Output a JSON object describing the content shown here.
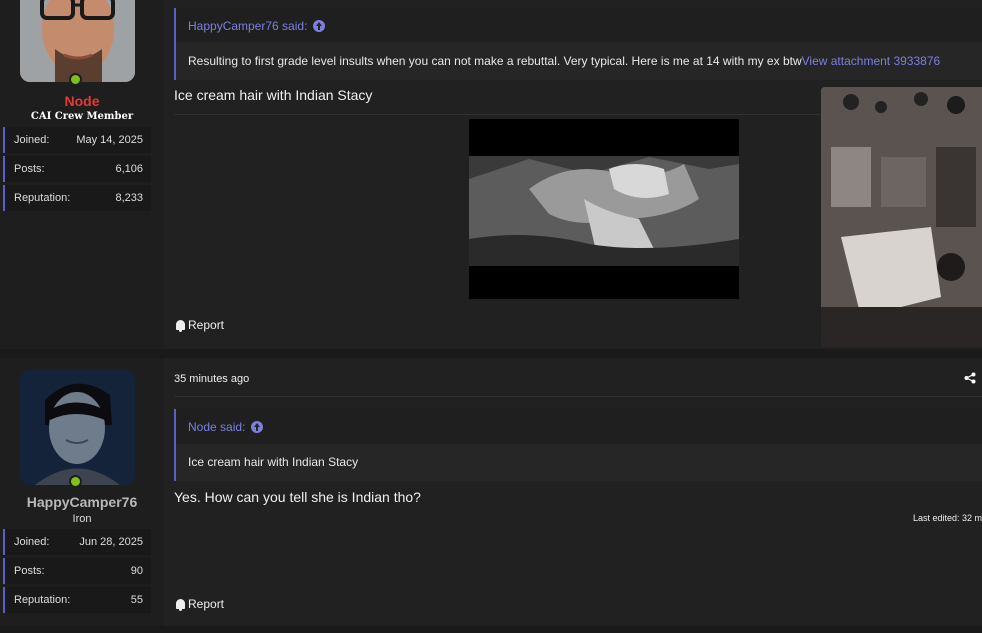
{
  "posts": [
    {
      "user": {
        "name": "Node",
        "title": "CAI Crew Member",
        "stats": [
          {
            "label": "Joined:",
            "value": "May 14, 2025"
          },
          {
            "label": "Posts:",
            "value": "6,106"
          },
          {
            "label": "Reputation:",
            "value": "8,233"
          }
        ]
      },
      "quote": {
        "author": "HappyCamper76 said:",
        "text": "Resulting to first grade level insults when you can not make a rebuttal. Very typical. Here is me at 14 with my ex btw",
        "link": "View attachment 3933876"
      },
      "body": "Ice cream hair with Indian Stacy",
      "report_label": "Report"
    },
    {
      "timestamp": "35 minutes ago",
      "user": {
        "name": "HappyCamper76",
        "title": "Iron",
        "stats": [
          {
            "label": "Joined:",
            "value": "Jun 28, 2025"
          },
          {
            "label": "Posts:",
            "value": "90"
          },
          {
            "label": "Reputation:",
            "value": "55"
          }
        ]
      },
      "quote": {
        "author": "Node said:",
        "text": "Ice cream hair with Indian Stacy"
      },
      "body": "Yes. How can you tell she is Indian tho?",
      "last_edited": "Last edited: 32 m",
      "report_label": "Report"
    }
  ],
  "colors": {
    "accent": "#5b5fc7",
    "link": "#7b7fe0",
    "online": "#7fc01b",
    "node_name": "#e53935",
    "happycamper_name": "#b9b9b9"
  },
  "icons": {
    "quote_jump": "arrow-up-circle-icon",
    "report": "bell-icon",
    "share": "share-icon"
  }
}
